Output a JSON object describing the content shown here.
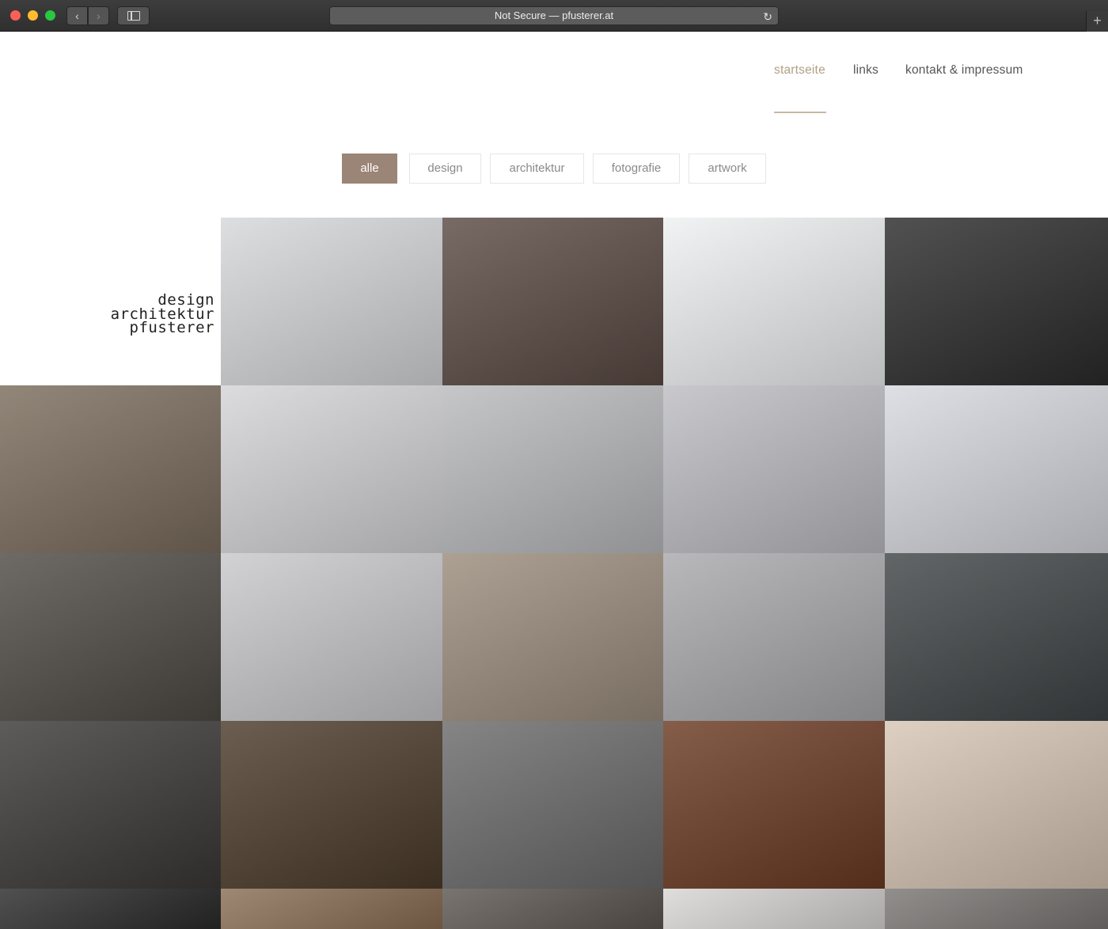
{
  "browser": {
    "url_text": "Not Secure — pfusterer.at",
    "back_icon": "chevron-left-icon",
    "forward_icon": "chevron-right-icon",
    "sidebar_icon": "sidebar-icon",
    "reload_icon": "reload-icon",
    "new_tab_icon": "plus-icon",
    "back_glyph": "‹",
    "forward_glyph": "›",
    "reload_glyph": "↻",
    "new_tab_glyph": "+"
  },
  "nav": {
    "items": [
      {
        "label": "startseite",
        "active": true
      },
      {
        "label": "links",
        "active": false
      },
      {
        "label": "kontakt & impressum",
        "active": false
      }
    ]
  },
  "filters": {
    "items": [
      {
        "label": "alle",
        "active": true
      },
      {
        "label": "design",
        "active": false
      },
      {
        "label": "architektur",
        "active": false
      },
      {
        "label": "fotografie",
        "active": false
      },
      {
        "label": "artwork",
        "active": false
      }
    ]
  },
  "logo": {
    "lines": [
      "design",
      "architektur",
      "pfusterer"
    ]
  },
  "colors": {
    "accent": "#b39e86",
    "filter_active_bg": "#9a8576"
  },
  "gallery": {
    "items": [
      {
        "name": "concrete-column-render",
        "bg": "#d5d7da"
      },
      {
        "name": "textured-panel-closeup",
        "bg": "#5a4a44"
      },
      {
        "name": "metal-shelf",
        "bg": "#eef0f1"
      },
      {
        "name": "portrait-woman-bw",
        "bg": "#2b2b2b"
      },
      {
        "name": "restaurant-counter-yoyo",
        "bg": "#7a6c5c"
      },
      {
        "name": "burgers-and-co-menu",
        "bg": "#d4d4d8"
      },
      {
        "name": "staircase-shelving",
        "bg": "#b9babd"
      },
      {
        "name": "kitchen-island-green",
        "bg": "#bdbcc2"
      },
      {
        "name": "gas-stove-cart",
        "bg": "#d7d8de"
      },
      {
        "name": "office-desk",
        "bg": "#4e4a44"
      },
      {
        "name": "floor-lamp-render",
        "bg": "#c8c8cc"
      },
      {
        "name": "kitchen-shelves",
        "bg": "#9a8c7c"
      },
      {
        "name": "bathroom-tub",
        "bg": "#a9a9ad"
      },
      {
        "name": "cafe-interior-dark",
        "bg": "#3f4446"
      },
      {
        "name": "pendant-lamp",
        "bg": "#3a3836"
      },
      {
        "name": "restroom-cabins",
        "bg": "#4b3b2b"
      },
      {
        "name": "bridge-walker-bw",
        "bg": "#6a6a6a"
      },
      {
        "name": "wooden-room-red-cubes",
        "bg": "#6a3a22"
      },
      {
        "name": "curtain-corner",
        "bg": "#d6c5b4"
      },
      {
        "name": "portrait-partial-bw",
        "bg": "#2a2a2a"
      },
      {
        "name": "kitchen-counter-partial",
        "bg": "#8a6e54"
      },
      {
        "name": "kitchen-pots-partial",
        "bg": "#5c5650"
      },
      {
        "name": "wall-partial",
        "bg": "#d9d6d4"
      },
      {
        "name": "ceiling-partial",
        "bg": "#7a7674"
      }
    ]
  }
}
